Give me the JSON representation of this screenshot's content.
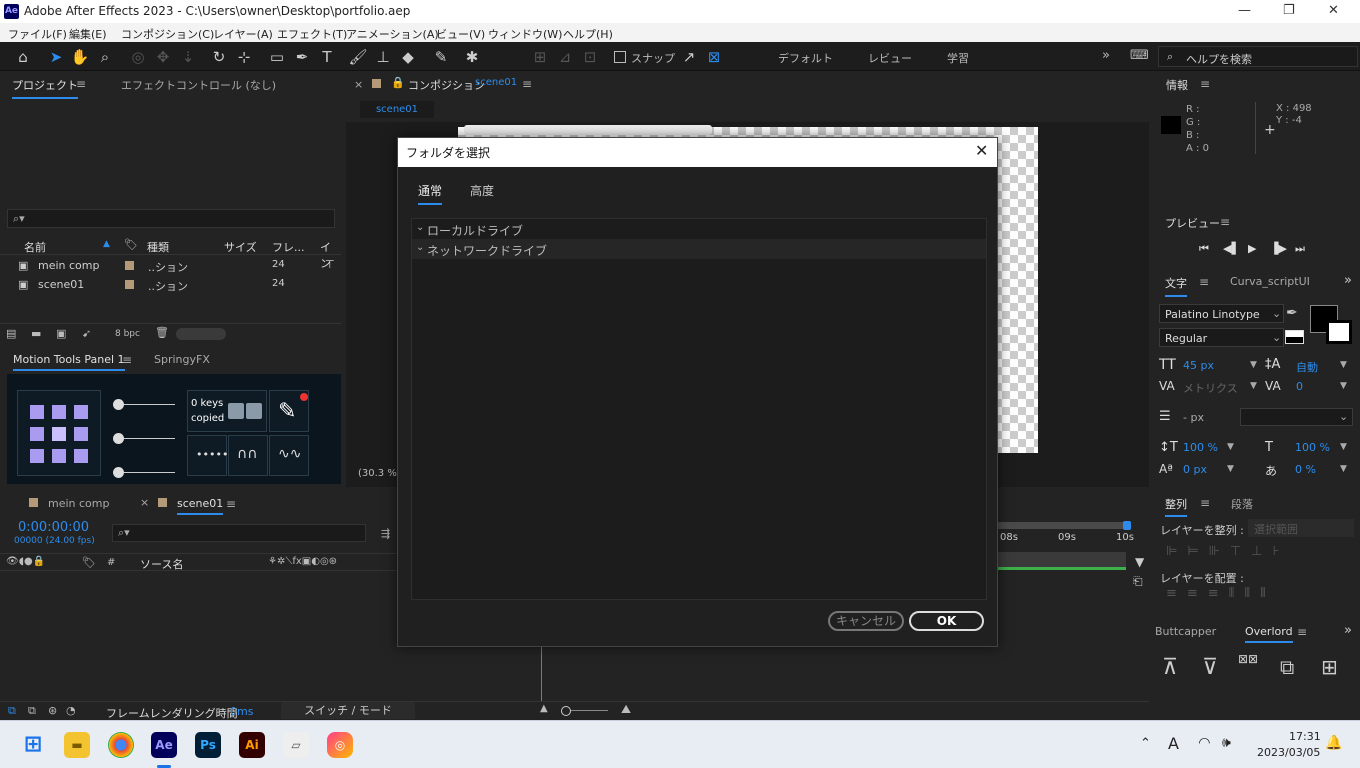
{
  "window": {
    "title": "Adobe After Effects 2023 - C:\\Users\\owner\\Desktop\\portfolio.aep",
    "app_icon": "Ae"
  },
  "menu": [
    "ファイル(F)",
    "編集(E)",
    "コンポジション(C)",
    "レイヤー(A)",
    "エフェクト(T)",
    "アニメーション(A)",
    "ビュー(V)",
    "ウィンドウ(W)",
    "ヘルプ(H)"
  ],
  "toolbar": {
    "snap_label": "スナップ",
    "workspaces": [
      "デフォルト",
      "レビュー",
      "学習"
    ],
    "help_placeholder": "ヘルプを検索"
  },
  "project_panel": {
    "tab_project": "プロジェクト",
    "tab_effects": "エフェクトコントロール (なし)",
    "columns": [
      "名前",
      "種類",
      "サイズ",
      "フレ...",
      "イン"
    ],
    "items": [
      {
        "name": "mein comp",
        "type": "..ション",
        "fps": "24"
      },
      {
        "name": "scene01",
        "type": "..ション",
        "fps": "24"
      }
    ],
    "bpc": "8 bpc"
  },
  "motion_tools": {
    "tab1": "Motion Tools Panel 1",
    "tab2": "SpringyFX",
    "keys_line1": "0 keys",
    "keys_line2": "copied"
  },
  "composition": {
    "tab_label": "コンポジション",
    "comp_name": "scene01",
    "subtab": "scene01",
    "zoom": "(30.3 %)"
  },
  "timeline": {
    "tab1": "mein comp",
    "tab2": "scene01",
    "timecode": "0:00:00:00",
    "frames": "00000 (24.00 fps)",
    "source_name": "ソース名",
    "layer_num": "#",
    "ticks": [
      "08s",
      "09s",
      "10s"
    ],
    "render_time_label": "フレームレンダリング時間",
    "render_time_value": "0ms",
    "switch_mode": "スイッチ / モード"
  },
  "info_panel": {
    "title": "情報",
    "r": "R :",
    "g": "G :",
    "b": "B :",
    "a": "A :  0",
    "x": "X : 498",
    "y": "Y : -4"
  },
  "preview_panel": {
    "title": "プレビュー"
  },
  "character_panel": {
    "tab1": "文字",
    "tab2": "Curva_scriptUI",
    "font": "Palatino Linotype",
    "style": "Regular",
    "size": "45 px",
    "leading": "自動",
    "kerning": "メトリクス",
    "tracking": "0",
    "stroke": "- px",
    "vscale": "100 %",
    "hscale": "100 %",
    "baseline": "0 px",
    "tsume": "0 %"
  },
  "align_panel": {
    "tab1": "整列",
    "tab2": "段落",
    "align_layers": "レイヤーを整列 :",
    "align_target": "選択範囲",
    "distribute": "レイヤーを配置 :"
  },
  "buttcapper": {
    "tab1": "Buttcapper",
    "tab2": "Overlord"
  },
  "dialog": {
    "title": "フォルダを選択",
    "tabs": [
      "通常",
      "高度"
    ],
    "tree": [
      "ローカルドライブ",
      "ネットワークドライブ"
    ],
    "cancel": "キャンセル",
    "ok": "OK"
  },
  "taskbar": {
    "time": "17:31",
    "date": "2023/03/05",
    "ime": "A"
  }
}
